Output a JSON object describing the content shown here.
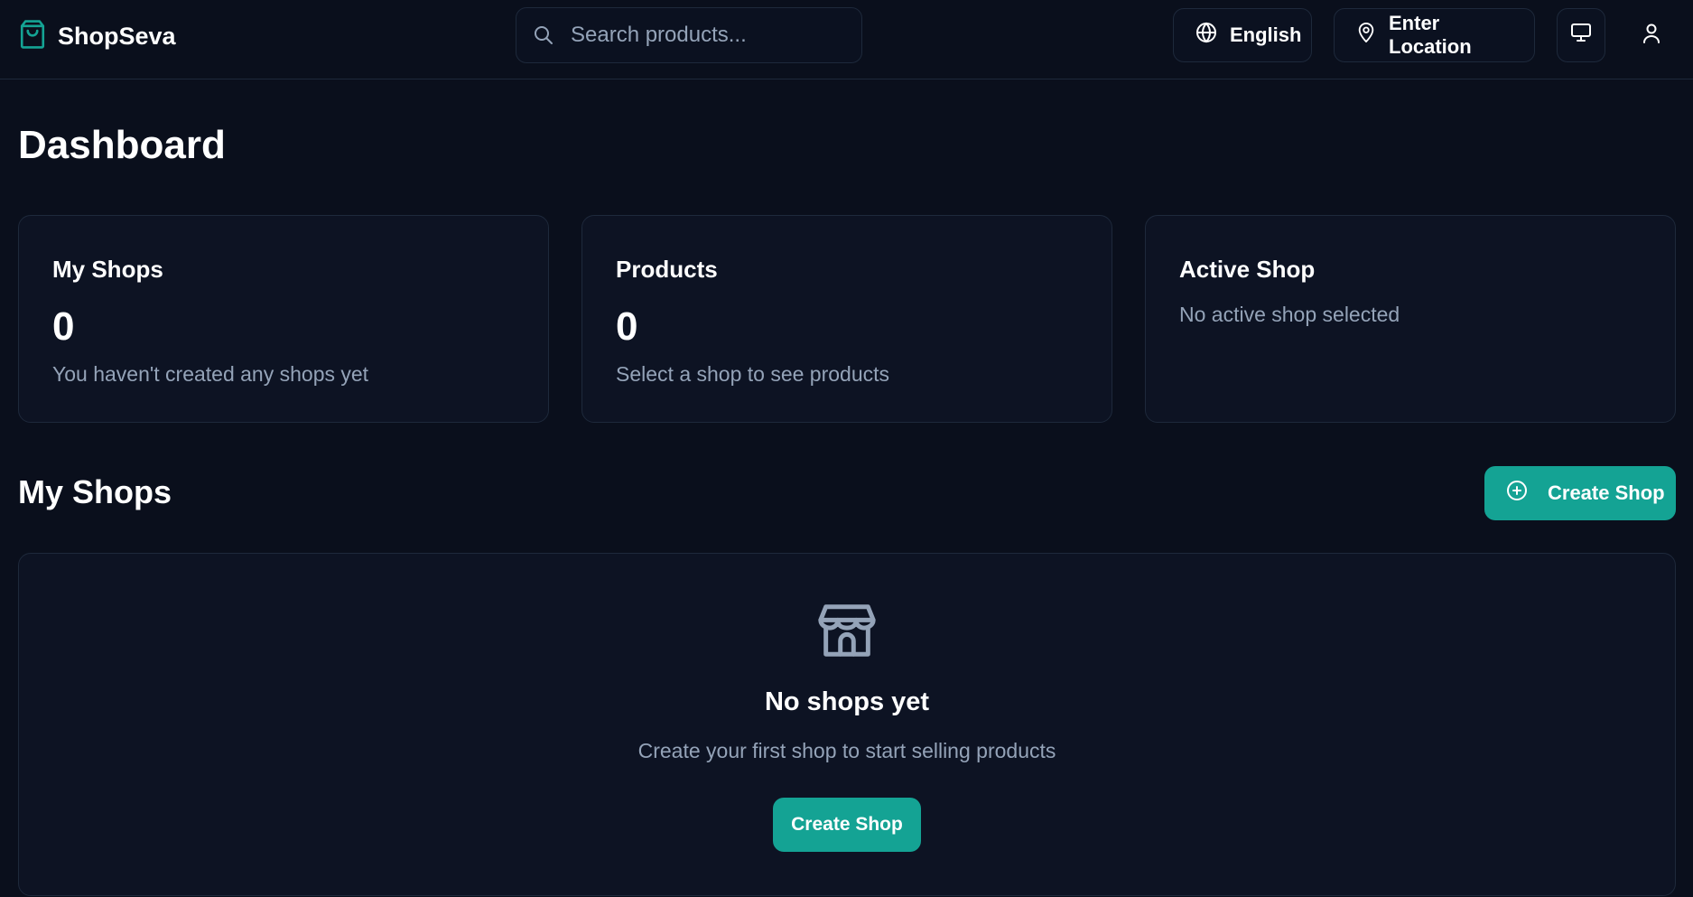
{
  "header": {
    "brand": "ShopSeva",
    "search_placeholder": "Search products...",
    "language_label": "English",
    "location_label": "Enter Location"
  },
  "page": {
    "title": "Dashboard"
  },
  "stats": [
    {
      "title": "My Shops",
      "value": "0",
      "description": "You haven't created any shops yet"
    },
    {
      "title": "Products",
      "value": "0",
      "description": "Select a shop to see products"
    },
    {
      "title": "Active Shop",
      "description": "No active shop selected"
    }
  ],
  "shops_section": {
    "title": "My Shops",
    "create_button_label": "Create Shop",
    "empty_title": "No shops yet",
    "empty_description": "Create your first shop to start selling products",
    "empty_button_label": "Create Shop"
  },
  "icons": {
    "brand": "shopping-bag-icon",
    "search": "search-icon",
    "language": "globe-icon",
    "location": "map-pin-icon",
    "display": "monitor-icon",
    "user": "user-icon",
    "create": "plus-circle-icon",
    "empty_state": "store-icon"
  },
  "colors": {
    "background": "#0a0f1c",
    "card": "#0d1323",
    "accent": "#14a394",
    "muted_text": "#94a3b8",
    "border": "#1e293b"
  }
}
